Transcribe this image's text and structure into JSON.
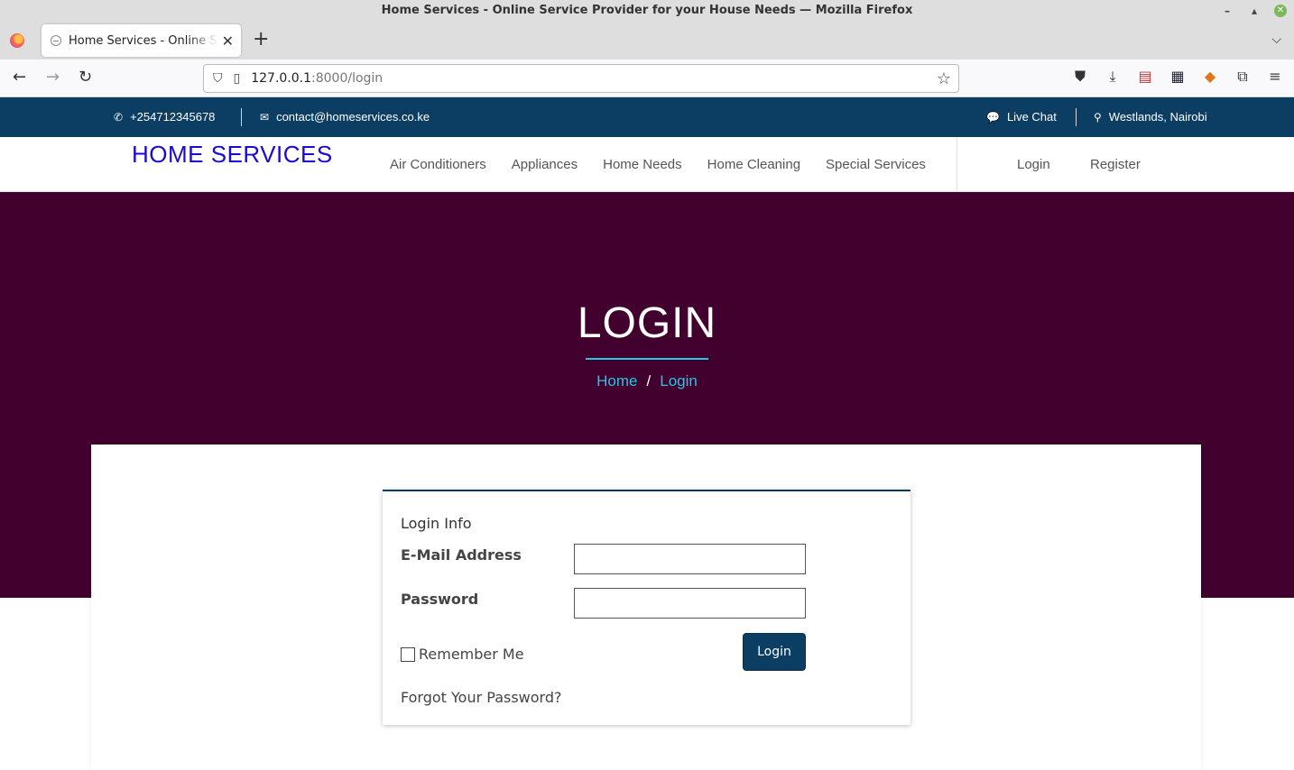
{
  "browser": {
    "window_title": "Home Services - Online Service Provider for your House Needs — Mozilla Firefox",
    "tab_title": "Home Services - Online Service Provider for your House Needs",
    "url_host": "127.0.0.1",
    "url_path": ":8000/login"
  },
  "topbar": {
    "phone": "+254712345678",
    "email": "contact@homeservices.co.ke",
    "live_chat": "Live Chat",
    "location": "Westlands, Nairobi"
  },
  "header": {
    "brand": "HOME SERVICES",
    "menu": [
      "Air Conditioners",
      "Appliances",
      "Home Needs",
      "Home Cleaning",
      "Special Services"
    ],
    "login": "Login",
    "register": "Register"
  },
  "hero": {
    "title": "LOGIN",
    "breadcrumb_home": "Home",
    "breadcrumb_sep": "/",
    "breadcrumb_current": "Login"
  },
  "form": {
    "title": "Login Info",
    "email_label": "E-Mail Address",
    "email_value": "",
    "password_label": "Password",
    "password_value": "",
    "remember_label": "Remember Me",
    "submit_label": "Login",
    "forgot_label": "Forgot Your Password?"
  },
  "colors": {
    "topbar_bg": "#0c3d63",
    "hero_bg": "#41002d",
    "accent": "#27c6e3",
    "brand": "#1a0ad4"
  }
}
